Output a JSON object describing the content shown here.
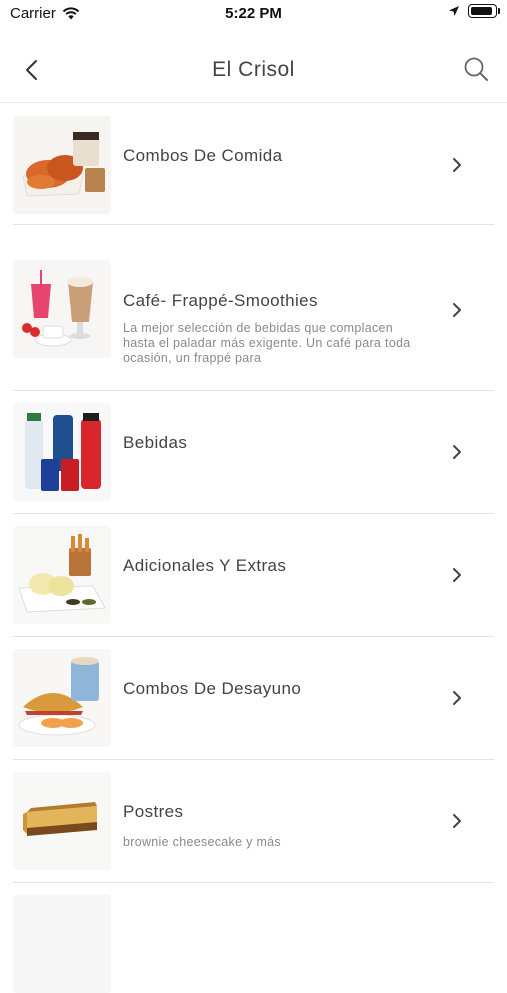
{
  "status_bar": {
    "carrier": "Carrier",
    "time": "5:22 PM"
  },
  "header": {
    "title": "El Crisol",
    "back_icon": "chevron-left-icon",
    "search_icon": "search-icon"
  },
  "categories": [
    {
      "name": "Combos De Comida",
      "description": "",
      "image": "fried-chicken-combo"
    },
    {
      "name": "Café- Frappé-Smoothies",
      "description": "La mejor selección de bebidas que complacen hasta el paladar más exigente. Un café para toda ocasión, un frappé para",
      "image": "coffee-drinks"
    },
    {
      "name": "Bebidas",
      "description": "",
      "image": "bottled-drinks"
    },
    {
      "name": "Adicionales Y Extras",
      "description": "",
      "image": "sides-and-sauces"
    },
    {
      "name": "Combos De Desayuno",
      "description": "",
      "image": "breakfast-croissant"
    },
    {
      "name": "Postres",
      "description": "brownie cheesecake y más",
      "image": "cheesecake-slice"
    }
  ],
  "colors": {
    "text": "#444444",
    "muted": "#8a8a8a",
    "divider": "#e3e3e3"
  }
}
